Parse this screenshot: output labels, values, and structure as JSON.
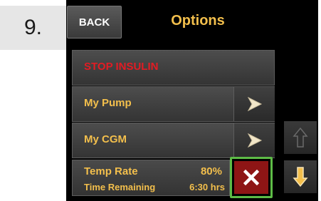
{
  "step_number": "9.",
  "header": {
    "back_label": "BACK",
    "title": "Options"
  },
  "menu": [
    {
      "label": "STOP INSULIN",
      "has_arrow": false
    },
    {
      "label": "My Pump",
      "has_arrow": true
    },
    {
      "label": "My CGM",
      "has_arrow": true
    }
  ],
  "status": {
    "temp_rate_label": "Temp Rate",
    "temp_rate_value": "80%",
    "time_remaining_label": "Time Remaining",
    "time_remaining_value": "6:30 hrs"
  },
  "icons": {
    "cancel": "close-icon",
    "row_arrow": "chevron-right-icon",
    "scroll_up": "arrow-up-icon",
    "scroll_down": "arrow-down-icon"
  },
  "colors": {
    "accent": "#f3bf4c",
    "danger": "#e31b23",
    "cancel_bg": "#8e1515",
    "highlight": "#5dbb46"
  }
}
